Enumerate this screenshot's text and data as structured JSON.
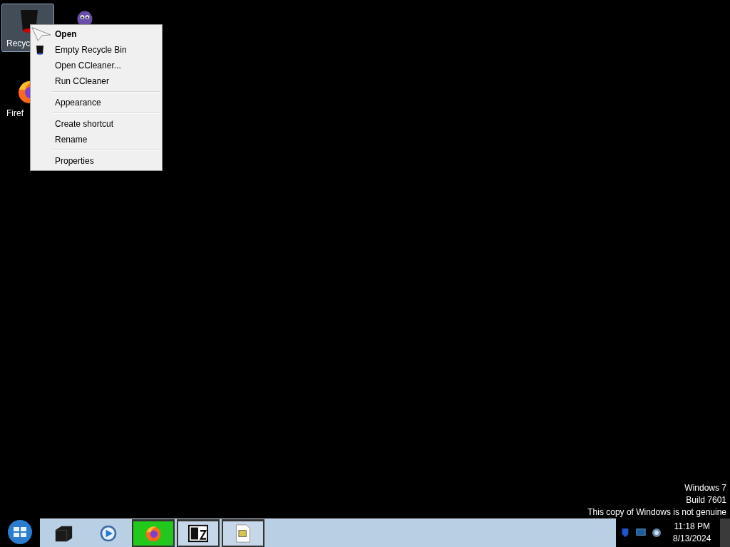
{
  "desktop_icons": [
    {
      "label": "Recyc",
      "kind": "bin",
      "selected": true
    },
    {
      "kind": "creature",
      "selected": false
    },
    {
      "label": "Firef",
      "kind": "firefox",
      "selected": false
    }
  ],
  "context_menu": [
    {
      "kind": "item",
      "label": "Open",
      "default": true
    },
    {
      "kind": "item_with_icon",
      "label": "Empty Recycle Bin",
      "default": false
    },
    {
      "kind": "item",
      "label": "Open CCleaner...",
      "default": false
    },
    {
      "kind": "item",
      "label": "Run CCleaner",
      "default": false
    },
    {
      "kind": "separator"
    },
    {
      "kind": "item",
      "label": "Appearance",
      "default": false
    },
    {
      "kind": "separator"
    },
    {
      "kind": "item",
      "label": "Create shortcut",
      "default": false
    },
    {
      "kind": "item",
      "label": "Rename",
      "default": false
    },
    {
      "kind": "separator"
    },
    {
      "kind": "item",
      "label": "Properties",
      "default": false
    }
  ],
  "watermark": [
    "Windows 7",
    "Build 7601",
    "This copy of Windows is not genuine"
  ],
  "taskbar": {
    "pinned": [
      {
        "kind": "printer",
        "active": false
      },
      {
        "kind": "media",
        "active": false
      },
      {
        "kind": "firefox",
        "active": true
      },
      {
        "kind": "sevenzip",
        "active": false
      },
      {
        "kind": "document",
        "active": false
      }
    ],
    "clock": {
      "time": "11:18 PM",
      "date": "8/13/2024"
    }
  }
}
